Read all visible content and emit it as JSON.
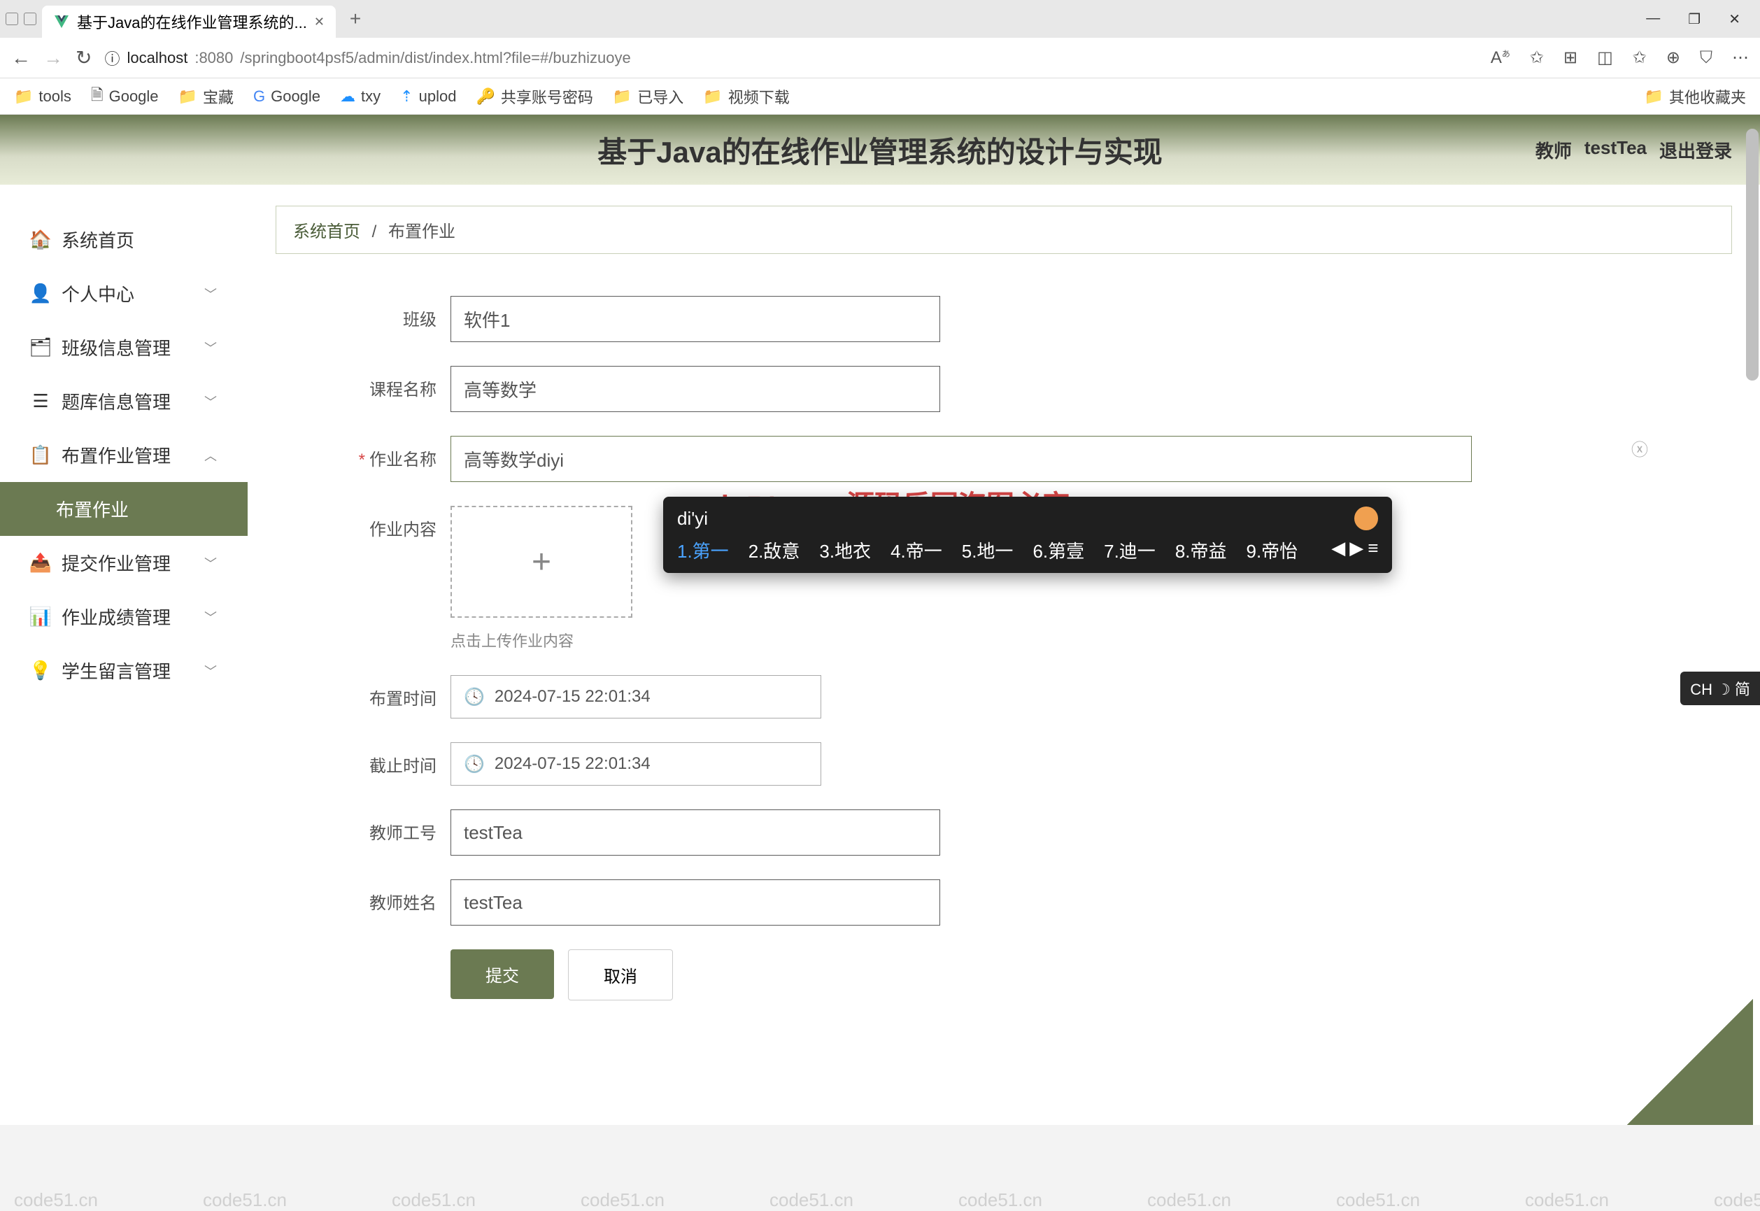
{
  "browser": {
    "tab_title": "基于Java的在线作业管理系统的...",
    "url_host": "localhost",
    "url_port": ":8080",
    "url_path": "/springboot4psf5/admin/dist/index.html?file=#/buzhizuoye"
  },
  "bookmarks": [
    "tools",
    "Google",
    "宝藏",
    "Google",
    "txy",
    "uplod",
    "共享账号密码",
    "已导入",
    "视频下载"
  ],
  "bookmarks_right": "其他收藏夹",
  "header": {
    "title": "基于Java的在线作业管理系统的设计与实现",
    "role": "教师",
    "username": "testTea",
    "logout": "退出登录"
  },
  "sidebar": {
    "items": [
      {
        "label": "系统首页",
        "icon": "home",
        "expandable": false
      },
      {
        "label": "个人中心",
        "icon": "person",
        "expandable": true
      },
      {
        "label": "班级信息管理",
        "icon": "class",
        "expandable": true
      },
      {
        "label": "题库信息管理",
        "icon": "list",
        "expandable": true
      },
      {
        "label": "布置作业管理",
        "icon": "assign",
        "expandable": true,
        "expanded": true
      },
      {
        "label": "布置作业",
        "icon": "",
        "sub": true,
        "active": true
      },
      {
        "label": "提交作业管理",
        "icon": "submit",
        "expandable": true
      },
      {
        "label": "作业成绩管理",
        "icon": "grade",
        "expandable": true
      },
      {
        "label": "学生留言管理",
        "icon": "message",
        "expandable": true
      }
    ]
  },
  "breadcrumb": {
    "home": "系统首页",
    "sep": "/",
    "current": "布置作业"
  },
  "form": {
    "class_label": "班级",
    "class_value": "软件1",
    "course_label": "课程名称",
    "course_value": "高等数学",
    "hw_name_label": "作业名称",
    "hw_name_value": "高等数学diyi",
    "content_label": "作业内容",
    "upload_hint": "点击上传作业内容",
    "assign_time_label": "布置时间",
    "assign_time_value": "2024-07-15 22:01:34",
    "due_time_label": "截止时间",
    "due_time_value": "2024-07-15 22:01:34",
    "teacher_id_label": "教师工号",
    "teacher_id_value": "testTea",
    "teacher_name_label": "教师姓名",
    "teacher_name_value": "testTea",
    "submit": "提交",
    "cancel": "取消"
  },
  "ime": {
    "input": "di'yi",
    "candidates": [
      "1.第一",
      "2.敌意",
      "3.地衣",
      "4.帝一",
      "5.地一",
      "6.第壹",
      "7.迪一",
      "8.帝益",
      "9.帝怡"
    ]
  },
  "ime_indicator": "CH ☽ 简",
  "watermark_text": "code51.cn",
  "stolen": "code51.cn-源码乐园盗图必究"
}
